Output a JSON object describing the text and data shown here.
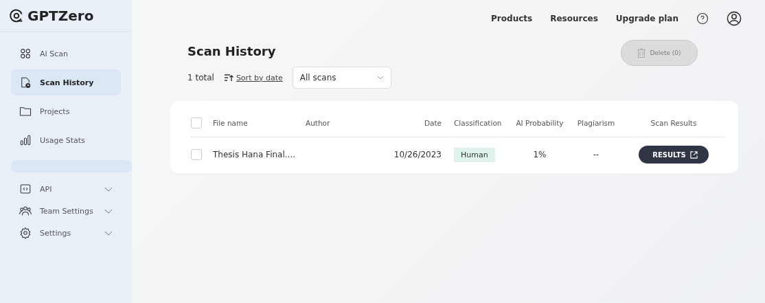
{
  "logo": {
    "text": "GPTZero"
  },
  "sidebar": {
    "items": [
      {
        "kind": "link",
        "label": "AI Scan",
        "selected": false
      },
      {
        "kind": "link",
        "label": "Scan History",
        "selected": true
      },
      {
        "kind": "link",
        "label": "Projects",
        "selected": false
      },
      {
        "kind": "link",
        "label": "Usage Stats",
        "selected": false
      },
      {
        "kind": "blank"
      },
      {
        "kind": "group",
        "label": "API",
        "expanded": false
      },
      {
        "kind": "group",
        "label": "Team Settings",
        "expanded": false
      },
      {
        "kind": "group",
        "label": "Settings",
        "expanded": false
      }
    ]
  },
  "top_nav": {
    "links": [
      "Products",
      "Resources",
      "Upgrade plan"
    ]
  },
  "page": {
    "title": "Scan History",
    "total": "1 total",
    "sort_link": "Sort by date",
    "filter": {
      "value": "All scans"
    },
    "delete_button": {
      "label": "Delete (0)",
      "disabled": true
    }
  },
  "table": {
    "columns": [
      "File name",
      "Author",
      "Date",
      "Classification",
      "AI Probability",
      "Plagiarism",
      "Scan Results"
    ],
    "header_checked": false,
    "rows": [
      {
        "checked": false,
        "file_name": "Thesis Hana Final....",
        "date": "10/26/2023",
        "classification": "Human",
        "ai_probability": "1%",
        "plagiarism": "--",
        "results_button": "RESULTS"
      }
    ]
  }
}
